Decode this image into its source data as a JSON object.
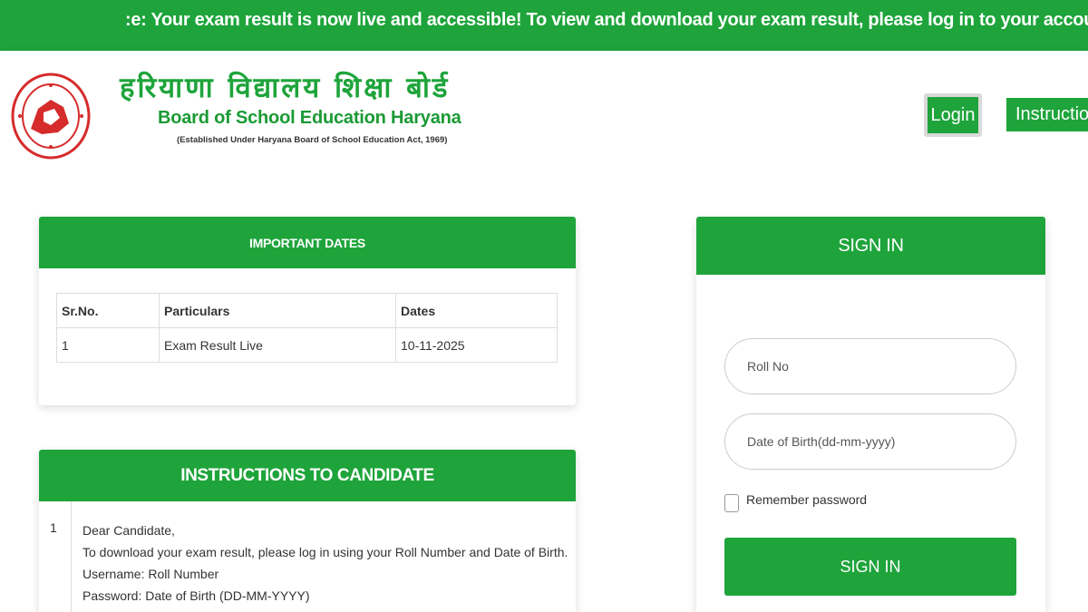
{
  "marquee": {
    "text": ":e: Your exam result is now live and accessible! To view and download your exam result, please log in to your account"
  },
  "header": {
    "logo_icon": "bseh-seal-icon",
    "title_hindi": "हरियाणा विद्यालय शिक्षा बोर्ड",
    "title_english": "Board of School Education Haryana",
    "subtitle": "(Established Under Haryana Board of School Education Act, 1969)",
    "login_label": "Login",
    "instruction_label": "Instruction"
  },
  "important_dates": {
    "heading": "IMPORTANT DATES",
    "columns": [
      "Sr.No.",
      "Particulars",
      "Dates"
    ],
    "rows": [
      [
        "1",
        "Exam Result Live",
        "10-11-2025"
      ]
    ]
  },
  "instructions": {
    "heading": "INSTRUCTIONS TO CANDIDATE",
    "number": "1",
    "lines": [
      "Dear Candidate,",
      "To download your exam result, please log in using your Roll Number and Date of Birth.",
      "Username: Roll Number",
      "Password: Date of Birth (DD-MM-YYYY)"
    ]
  },
  "signin": {
    "heading": "SIGN IN",
    "roll_placeholder": "Roll No",
    "dob_placeholder": "Date of Birth(dd-mm-yyyy)",
    "remember_label": "Remember password",
    "button_label": "SIGN IN"
  },
  "colors": {
    "brand_green": "#1ea43b",
    "text": "#333333",
    "border": "#dddddd"
  }
}
